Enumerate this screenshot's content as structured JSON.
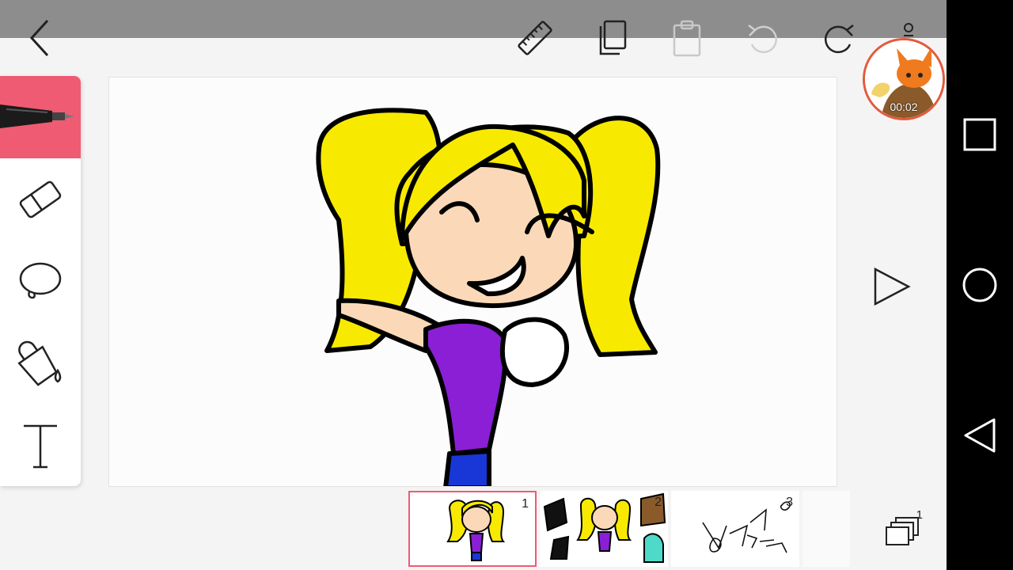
{
  "toolbar": {
    "back_icon": "chevron-left-icon",
    "ruler_icon": "ruler-icon",
    "copy_icon": "copy-icon",
    "paste_icon": "paste-icon",
    "undo_icon": "undo-icon",
    "redo_icon": "redo-icon",
    "menu_icon": "more-vertical-icon"
  },
  "tools": [
    {
      "name": "pen",
      "icon": "pen-icon",
      "active": true
    },
    {
      "name": "eraser",
      "icon": "eraser-icon",
      "active": false
    },
    {
      "name": "lasso",
      "icon": "lasso-icon",
      "active": false
    },
    {
      "name": "fill",
      "icon": "paint-bucket-icon",
      "active": false
    },
    {
      "name": "text",
      "icon": "text-icon",
      "active": false
    }
  ],
  "recording": {
    "time": "00:02",
    "avatar": "fox-avatar"
  },
  "frames": [
    {
      "number": "1",
      "selected": true
    },
    {
      "number": "2",
      "selected": false
    },
    {
      "number": "3",
      "selected": false
    }
  ],
  "layers": {
    "count": "1"
  },
  "colors": {
    "accent": "#ee5b73",
    "hair": "#f7ea00",
    "skin": "#fbd9b8",
    "shirt": "#8a1fd6",
    "pants": "#1837d6"
  }
}
